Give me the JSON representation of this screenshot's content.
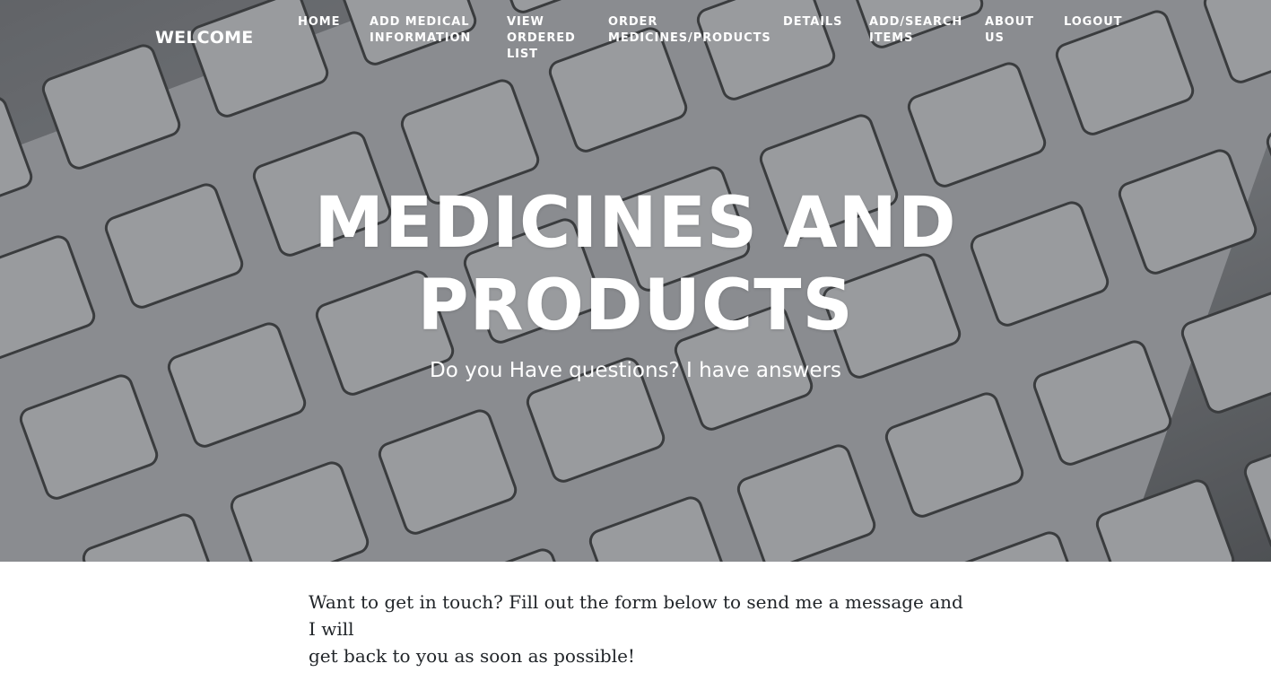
{
  "nav": {
    "brand": "WELCOME",
    "items": [
      {
        "lines": [
          "HOME"
        ]
      },
      {
        "lines": [
          "ADD MEDICAL",
          "INFORMATION"
        ]
      },
      {
        "lines": [
          "VIEW",
          "ORDERED",
          "LIST"
        ]
      },
      {
        "lines": [
          "ORDER",
          "MEDICINES/PRODUCTS"
        ]
      },
      {
        "lines": [
          "DETAILS"
        ]
      },
      {
        "lines": [
          "ADD/SEARCH",
          "ITEMS"
        ]
      },
      {
        "lines": [
          "ABOUT",
          "US"
        ]
      },
      {
        "lines": [
          "LOGOUT"
        ]
      }
    ]
  },
  "hero": {
    "title_line1": "MEDICINES AND",
    "title_line2": "PRODUCTS",
    "subtitle": "Do you Have questions? I have answers",
    "background": "keyboard-photo"
  },
  "main": {
    "intro_line1": "Want to get in touch? Fill out the form below to send me a message and I will",
    "intro_line2": "get back to you as soon as possible!"
  }
}
